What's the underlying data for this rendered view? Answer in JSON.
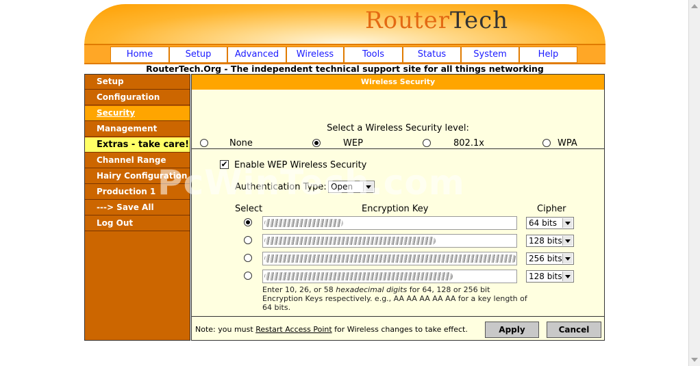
{
  "logo": {
    "part1": "Rou",
    "part2": "ter",
    "part3": "Tech"
  },
  "nav": [
    {
      "label": "Home"
    },
    {
      "label": "Setup"
    },
    {
      "label": "Advanced"
    },
    {
      "label": "Wireless"
    },
    {
      "label": "Tools"
    },
    {
      "label": "Status"
    },
    {
      "label": "System"
    },
    {
      "label": "Help"
    }
  ],
  "tagline": "RouterTech.Org - The independent technical support site for all things networking",
  "sidebar": [
    {
      "label": "Setup"
    },
    {
      "label": "Configuration"
    },
    {
      "label": "Security",
      "state": "active"
    },
    {
      "label": "Management"
    },
    {
      "label": "Extras - take care!",
      "state": "warning"
    },
    {
      "label": "Channel Range"
    },
    {
      "label": "Hairy Configuration"
    },
    {
      "label": "Production 1"
    },
    {
      "label": "---> Save All"
    },
    {
      "label": "Log Out"
    }
  ],
  "main": {
    "header": "Wireless Security",
    "prompt": "Select a Wireless Security level:",
    "levels": [
      {
        "label": "None",
        "selected": false
      },
      {
        "label": "WEP",
        "selected": true
      },
      {
        "label": "802.1x",
        "selected": false
      },
      {
        "label": "WPA",
        "selected": false
      }
    ],
    "enable_wep": {
      "label": "Enable WEP Wireless Security",
      "checked": true,
      "mark": "✔"
    },
    "auth": {
      "label": "Authentication Type:",
      "value": "Open"
    },
    "columns": {
      "select": "Select",
      "key": "Encryption Key",
      "cipher": "Cipher"
    },
    "keys": [
      {
        "selected": true,
        "cipher": "64 bits"
      },
      {
        "selected": false,
        "cipher": "128 bits"
      },
      {
        "selected": false,
        "cipher": "256 bits"
      },
      {
        "selected": false,
        "cipher": "128 bits"
      }
    ],
    "help": {
      "part1": "Enter 10, 26, or 58 ",
      "italic": "hexadecimal digits",
      "part2": " for 64, 128 or 256 bit Encryption Keys respectively. e.g., AA AA AA AA AA for a key length of 64 bits."
    },
    "note": {
      "prefix": "Note: you must ",
      "link": "Restart Access Point",
      "suffix": " for Wireless changes to take effect."
    },
    "apply": "Apply",
    "cancel": "Cancel"
  },
  "watermark": "PcWinTech.com"
}
